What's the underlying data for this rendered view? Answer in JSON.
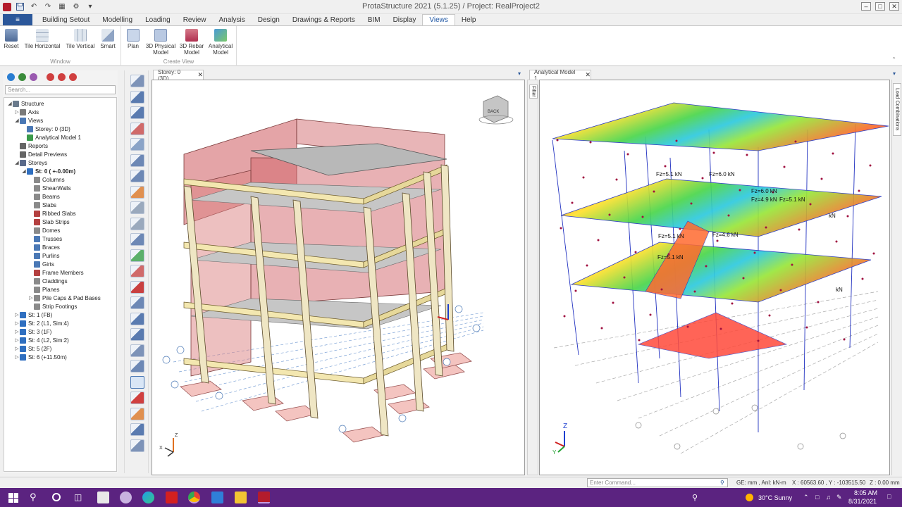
{
  "window": {
    "title": "ProtaStructure 2021 (5.1.25) / Project: RealProject2",
    "controls": [
      "–",
      "□",
      "✕"
    ]
  },
  "ribbon": {
    "file_label": "≡",
    "tabs": [
      "Building Setout",
      "Modelling",
      "Loading",
      "Review",
      "Analysis",
      "Design",
      "Drawings & Reports",
      "BIM",
      "Display",
      "Views",
      "Help"
    ],
    "active_tab": "Views",
    "groups": [
      {
        "label": "Window",
        "buttons": [
          "Reset",
          "Tile Horizontal",
          "Tile Vertical",
          "Smart"
        ]
      },
      {
        "label": "Create View",
        "buttons": [
          "Plan",
          "3D Physical Model",
          "3D Rebar Model",
          "Analytical Model"
        ]
      }
    ]
  },
  "explorer": {
    "search_placeholder": "Search...",
    "tree": [
      {
        "label": "Structure",
        "level": 0,
        "expander": "◢",
        "icon": "structure-icon",
        "color": "#6a7a8c"
      },
      {
        "label": "Axis",
        "level": 1,
        "expander": "▷",
        "icon": "axis-icon",
        "color": "#7a7a7a"
      },
      {
        "label": "Views",
        "level": 1,
        "expander": "◢",
        "icon": "views-icon",
        "color": "#4a78b5"
      },
      {
        "label": "Storey: 0 (3D)",
        "level": 2,
        "expander": "",
        "icon": "view-3d-icon",
        "color": "#4a78b5"
      },
      {
        "label": "Analytical Model 1",
        "level": 2,
        "expander": "",
        "icon": "analytical-icon",
        "color": "#3a9a4a"
      },
      {
        "label": "Reports",
        "level": 1,
        "expander": "",
        "icon": "reports-icon",
        "color": "#666666"
      },
      {
        "label": "Detail Previews",
        "level": 1,
        "expander": "",
        "icon": "detail-previews-icon",
        "color": "#666666"
      },
      {
        "label": "Storeys",
        "level": 1,
        "expander": "◢",
        "icon": "storeys-icon",
        "color": "#5a6a8a"
      },
      {
        "label": "St: 0 ( +-0.00m)",
        "level": 2,
        "expander": "◢",
        "icon": "storey-icon",
        "color": "#2f6fc0",
        "bold": true
      },
      {
        "label": "Columns",
        "level": 3,
        "expander": "",
        "icon": "columns-icon",
        "color": "#8a8a8a"
      },
      {
        "label": "ShearWalls",
        "level": 3,
        "expander": "",
        "icon": "shearwalls-icon",
        "color": "#8a8a8a"
      },
      {
        "label": "Beams",
        "level": 3,
        "expander": "",
        "icon": "beams-icon",
        "color": "#8a8a8a"
      },
      {
        "label": "Slabs",
        "level": 3,
        "expander": "",
        "icon": "slabs-icon",
        "color": "#8a8a8a"
      },
      {
        "label": "Ribbed Slabs",
        "level": 3,
        "expander": "",
        "icon": "ribbed-slabs-icon",
        "color": "#b44040"
      },
      {
        "label": "Slab Strips",
        "level": 3,
        "expander": "",
        "icon": "slab-strips-icon",
        "color": "#b44040"
      },
      {
        "label": "Domes",
        "level": 3,
        "expander": "",
        "icon": "domes-icon",
        "color": "#8a8a8a"
      },
      {
        "label": "Trusses",
        "level": 3,
        "expander": "",
        "icon": "trusses-icon",
        "color": "#4a78b5"
      },
      {
        "label": "Braces",
        "level": 3,
        "expander": "",
        "icon": "braces-icon",
        "color": "#4a78b5"
      },
      {
        "label": "Purlins",
        "level": 3,
        "expander": "",
        "icon": "purlins-icon",
        "color": "#4a78b5"
      },
      {
        "label": "Girts",
        "level": 3,
        "expander": "",
        "icon": "girts-icon",
        "color": "#4a78b5"
      },
      {
        "label": "Frame Members",
        "level": 3,
        "expander": "",
        "icon": "frame-members-icon",
        "color": "#b44040"
      },
      {
        "label": "Claddings",
        "level": 3,
        "expander": "",
        "icon": "claddings-icon",
        "color": "#8a8a8a"
      },
      {
        "label": "Planes",
        "level": 3,
        "expander": "",
        "icon": "planes-icon",
        "color": "#8a8a8a"
      },
      {
        "label": "Pile Caps & Pad Bases",
        "level": 3,
        "expander": "▷",
        "icon": "pile-caps-icon",
        "color": "#8a8a8a"
      },
      {
        "label": "Strip Footings",
        "level": 3,
        "expander": "",
        "icon": "strip-footings-icon",
        "color": "#8a8a8a"
      },
      {
        "label": "St: 1 (FB)",
        "level": 1,
        "expander": "▷",
        "icon": "storey-icon",
        "color": "#2f6fc0"
      },
      {
        "label": "St: 2 (L1, Sim:4)",
        "level": 1,
        "expander": "▷",
        "icon": "storey-icon",
        "color": "#2f6fc0"
      },
      {
        "label": "St: 3 (1F)",
        "level": 1,
        "expander": "▷",
        "icon": "storey-icon",
        "color": "#2f6fc0"
      },
      {
        "label": "St: 4 (L2, Sim:2)",
        "level": 1,
        "expander": "▷",
        "icon": "storey-icon",
        "color": "#2f6fc0"
      },
      {
        "label": "St: 5 (2F)",
        "level": 1,
        "expander": "▷",
        "icon": "storey-icon",
        "color": "#2f6fc0"
      },
      {
        "label": "St: 6 (+11.50m)",
        "level": 1,
        "expander": "▷",
        "icon": "storey-icon",
        "color": "#2f6fc0"
      }
    ]
  },
  "panels": {
    "left_tab": "Storey: 0 (3D)",
    "right_tab": "Analytical Model 1",
    "close": "✕",
    "filter_label": "Filter",
    "load_combinations_label": "Load Combinations",
    "viewcube_label": "BACK",
    "axis_labels": {
      "z": "Z",
      "x": "X",
      "y": "Y"
    },
    "force_labels": [
      "Fz=5.1 kN",
      "Fz=6.0 kN",
      "Fz=5.1 kN",
      "Fz=4.6 kN",
      "Fz=5.1 kN",
      "Fz=6.0 kN",
      "Fz=4.9 kN",
      "Fz=5.1 kN",
      "kN",
      "kN"
    ]
  },
  "status": {
    "command_placeholder": "Enter Command...",
    "units": "GE: mm , Anl: kN-m",
    "coords": "X : 60563.60 , Y : -103515.50",
    "z": "Z : 0.00 mm"
  },
  "taskbar": {
    "weather": "30°C Sunny",
    "time": "8:05 AM",
    "date": "8/31/2021",
    "accent": "#5b2380"
  },
  "colors": {
    "brand": "#b41c2c",
    "ribbon_accent": "#1e56a3",
    "file_tab": "#2b579a"
  }
}
